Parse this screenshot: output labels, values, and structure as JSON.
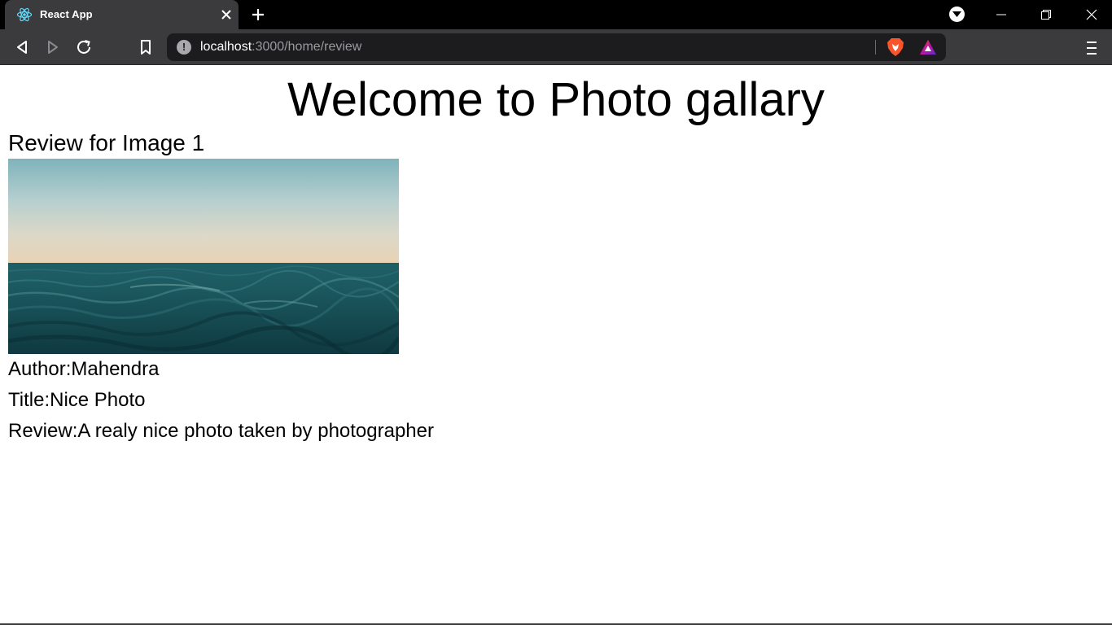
{
  "browser": {
    "tab": {
      "title": "React App",
      "favicon": "react-logo-icon"
    },
    "url": {
      "host": "localhost",
      "rest": ":3000/home/review"
    },
    "icons": {
      "back": "back-arrow-icon",
      "forward": "forward-arrow-icon",
      "reload": "reload-icon",
      "bookmark": "bookmark-icon",
      "site_info": "info-icon",
      "shields": "brave-shields-icon",
      "rewards": "brave-rewards-icon",
      "menu": "hamburger-menu-icon"
    },
    "colors": {
      "tabstrip": "#000000",
      "toolbar": "#3b3b3d",
      "urlbar": "#1c1c1e",
      "brave_orange": "#fb542b"
    }
  },
  "page": {
    "title": "Welcome to Photo gallary",
    "review_heading": "Review for Image 1",
    "author_line": "Author:Mahendra",
    "title_line": "Title:Nice Photo",
    "review_line": "Review:A realy nice photo taken by photographer"
  }
}
